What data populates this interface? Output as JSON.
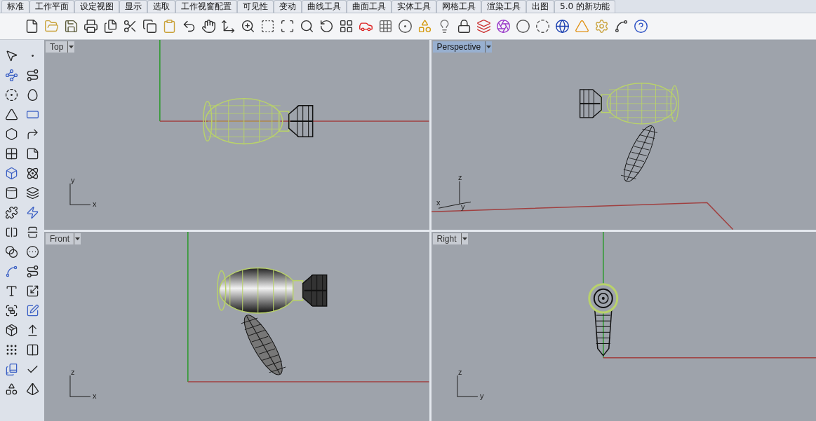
{
  "tabs": [
    {
      "label": "标准",
      "selected": false
    },
    {
      "label": "工作平面",
      "selected": false
    },
    {
      "label": "设定视图",
      "selected": false
    },
    {
      "label": "显示",
      "selected": false
    },
    {
      "label": "选取",
      "selected": false
    },
    {
      "label": "工作视窗配置",
      "selected": false
    },
    {
      "label": "可见性",
      "selected": false
    },
    {
      "label": "变动",
      "selected": false
    },
    {
      "label": "曲线工具",
      "selected": false
    },
    {
      "label": "曲面工具",
      "selected": false
    },
    {
      "label": "实体工具",
      "selected": false
    },
    {
      "label": "网格工具",
      "selected": false
    },
    {
      "label": "渲染工具",
      "selected": false
    },
    {
      "label": "出图",
      "selected": false
    },
    {
      "label": "5.0 的新功能",
      "selected": false
    }
  ],
  "viewports": [
    {
      "title": "Top",
      "kind": "top",
      "selected": false,
      "axes": [
        "y",
        "x"
      ]
    },
    {
      "title": "Perspective",
      "kind": "perspective",
      "selected": true,
      "axes": [
        "z",
        "x",
        "y"
      ]
    },
    {
      "title": "Front",
      "kind": "front",
      "selected": false,
      "axes": [
        "z",
        "x"
      ]
    },
    {
      "title": "Right",
      "kind": "right",
      "selected": false,
      "axes": [
        "z",
        "y"
      ]
    }
  ]
}
